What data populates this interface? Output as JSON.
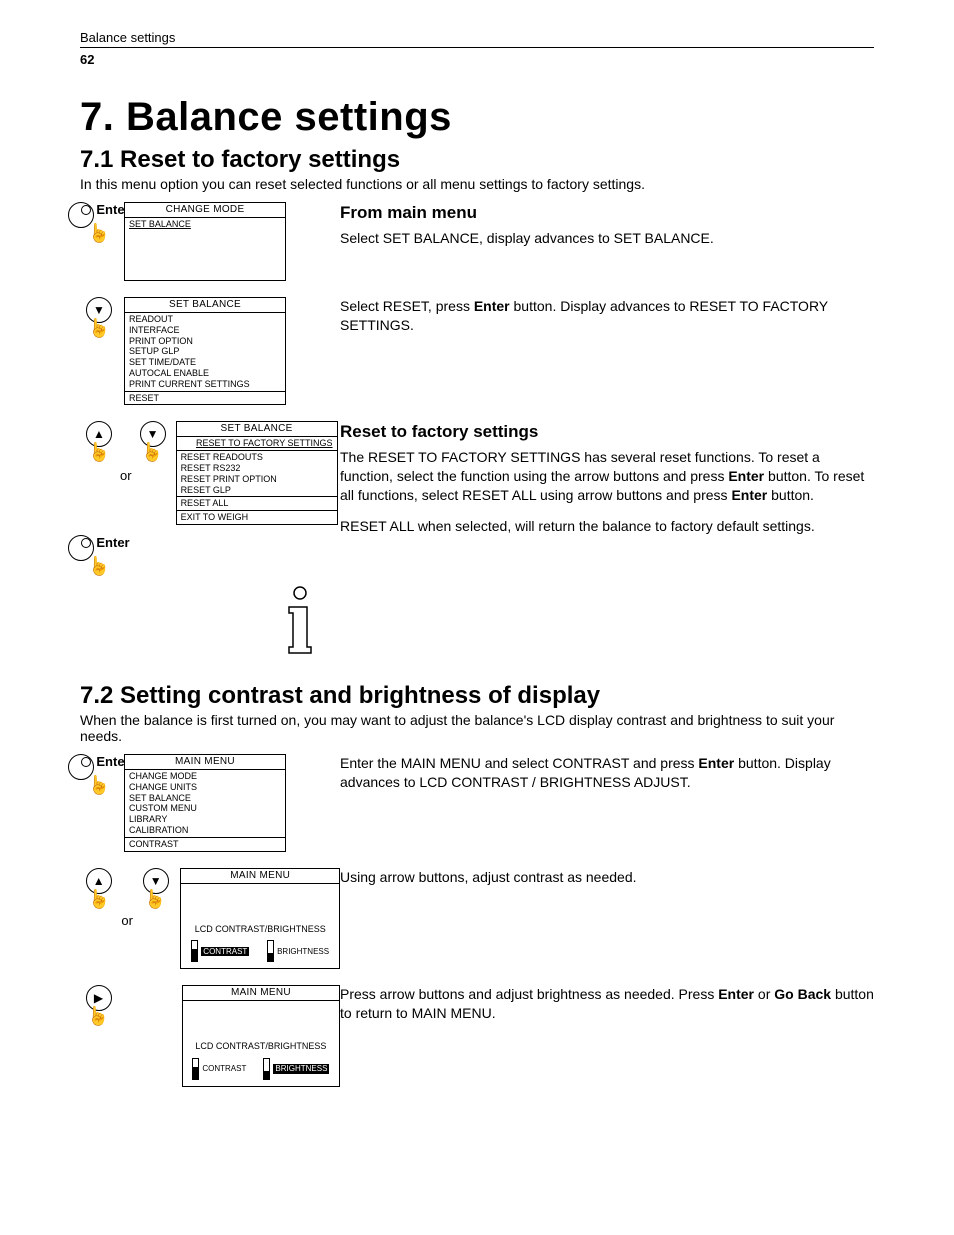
{
  "header": {
    "running_title": "Balance settings",
    "page_number": "62"
  },
  "chapter": {
    "number": "7.",
    "title": "Balance settings"
  },
  "section1": {
    "heading": "7.1  Reset to factory settings",
    "intro": "In this menu option you can reset selected functions or all menu settings to factory settings.",
    "step1": {
      "btn_label": "Enter",
      "lcd_title": "CHANGE MODE",
      "lcd_line1": "SET BALANCE",
      "sub_heading": "From main menu",
      "text": "Select SET BALANCE, display advances to SET BALANCE."
    },
    "step2": {
      "lcd_title": "SET BALANCE",
      "lcd_lines": [
        "READOUT",
        "INTERFACE",
        "PRINT OPTION",
        "SETUP GLP",
        "SET TIME/DATE",
        "AUTOCAL ENABLE",
        "PRINT CURRENT SETTINGS"
      ],
      "lcd_footer": "RESET",
      "text_a": "Select RESET, press ",
      "bold_a": "Enter",
      "text_b": " button. Display advances to RESET TO FACTORY SETTINGS."
    },
    "step3": {
      "or_label": "or",
      "btn_label": "Enter",
      "lcd_title": "SET BALANCE",
      "lcd_sel": "RESET TO FACTORY SETTINGS",
      "lcd_lines": [
        "RESET READOUTS",
        "RESET RS232",
        "RESET PRINT OPTION",
        "RESET GLP"
      ],
      "lcd_mid": "RESET ALL",
      "lcd_footer": "EXIT TO WEIGH",
      "sub_heading": "Reset to factory settings",
      "p1a": "The RESET TO FACTORY SETTINGS has several reset functions. To reset a function, select the function using the arrow buttons and press ",
      "p1b": "Enter",
      "p1c": " button. To reset all functions, select RESET ALL using arrow buttons and press ",
      "p1d": "Enter",
      "p1e": " button.",
      "p2": "RESET ALL when selected, will return the balance to factory default settings."
    }
  },
  "section2": {
    "heading": "7.2  Setting contrast and brightness of display",
    "intro": "When the balance is first turned on, you may want to adjust the balance's LCD display contrast and brightness to suit your needs.",
    "step1": {
      "btn_label": "Enter",
      "lcd_title": "MAIN MENU",
      "lcd_lines": [
        "CHANGE MODE",
        "CHANGE UNITS",
        "SET BALANCE",
        "CUSTOM MENU",
        "LIBRARY",
        "CALIBRATION"
      ],
      "lcd_footer": "CONTRAST",
      "text_a": "Enter the MAIN MENU and select CONTRAST and press ",
      "bold_a": "Enter",
      "text_b": " button. Display advances to LCD CONTRAST / BRIGHTNESS ADJUST."
    },
    "step2": {
      "or_label": "or",
      "lcd_title": "MAIN MENU",
      "lcd_sub": "LCD CONTRAST/BRIGHTNESS",
      "slider1": "CONTRAST",
      "slider2": "BRIGHTNESS",
      "text": "Using arrow buttons, adjust contrast as needed."
    },
    "step3": {
      "lcd_title": "MAIN MENU",
      "lcd_sub": "LCD CONTRAST/BRIGHTNESS",
      "slider1": "CONTRAST",
      "slider2": "BRIGHTNESS",
      "text_a": "Press arrow buttons and adjust brightness as needed. Press ",
      "bold_a": "Enter",
      "text_b": " or ",
      "bold_b": "Go Back",
      "text_c": " button to return to MAIN MENU."
    }
  }
}
